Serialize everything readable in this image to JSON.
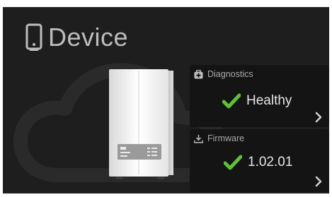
{
  "header": {
    "title": "Device",
    "icon": "device-icon"
  },
  "device_image": {
    "icon": "nas-device-image"
  },
  "diagnostics": {
    "label": "Diagnostics",
    "label_icon": "first-aid-kit-icon",
    "status": "Healthy",
    "status_icon": "check-icon",
    "action_icon": "chevron-right-icon"
  },
  "firmware": {
    "label": "Firmware",
    "label_icon": "download-icon",
    "version": "1.02.01",
    "status_icon": "check-icon",
    "action_icon": "chevron-right-icon"
  },
  "colors": {
    "panel_bg": "#1e1e1e",
    "card_bg": "#141414",
    "check_green": "#5fbf3a",
    "text_light": "#e6e6e6",
    "text_muted": "#a9a9a9"
  }
}
